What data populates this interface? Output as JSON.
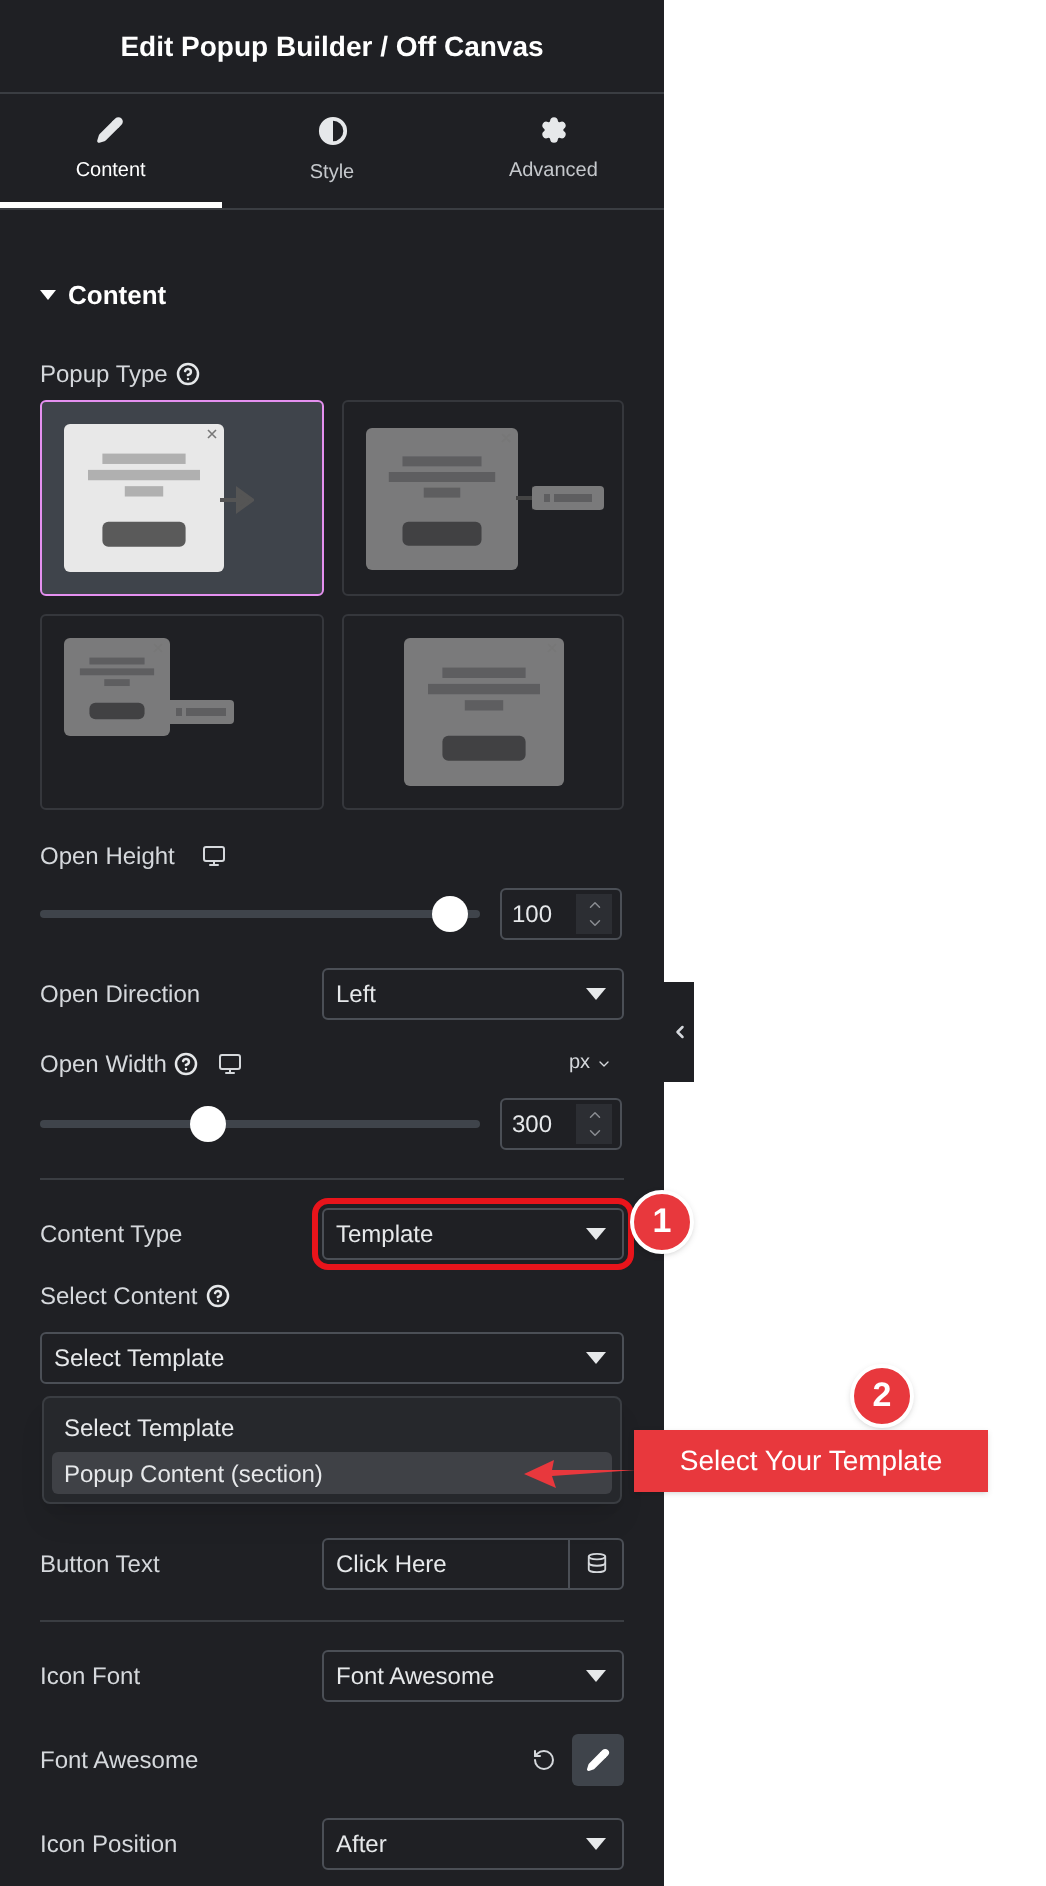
{
  "header": {
    "title": "Edit Popup Builder / Off Canvas"
  },
  "tabs": [
    {
      "label": "Content",
      "kind": "pencil",
      "selected": true
    },
    {
      "label": "Style",
      "kind": "contrast",
      "selected": false
    },
    {
      "label": "Advanced",
      "kind": "gear",
      "selected": false
    }
  ],
  "section": {
    "title": "Content",
    "expanded": true
  },
  "popup_type": {
    "label": "Popup Type",
    "options": [
      {
        "kind": "slide",
        "selected": true
      },
      {
        "kind": "slide-tab",
        "selected": false
      },
      {
        "kind": "small-tab",
        "selected": false
      },
      {
        "kind": "center",
        "selected": false
      }
    ]
  },
  "open_height": {
    "label": "Open Height",
    "level": 0.97,
    "value": "100"
  },
  "open_direction": {
    "label": "Open Direction",
    "value": "Left"
  },
  "open_width": {
    "label": "Open Width",
    "unit": "px",
    "level": 0.37,
    "value": "300"
  },
  "content_type": {
    "label": "Content Type",
    "value": "Template",
    "highlighted": true
  },
  "select_content": {
    "label": "Select Content",
    "value": "Select Template",
    "options": [
      {
        "label": "Select Template",
        "highlighted": false
      },
      {
        "label": "Popup Content (section)",
        "highlighted": true
      }
    ]
  },
  "button_text": {
    "label": "Button Text",
    "value": "Click Here"
  },
  "icon_font": {
    "label": "Icon Font",
    "value": "Font Awesome"
  },
  "font_awesome": {
    "label": "Font Awesome"
  },
  "icon_position": {
    "label": "Icon Position",
    "value": "After"
  },
  "annotations": [
    {
      "number": "1"
    },
    {
      "number": "2",
      "callout": "Select Your Template"
    }
  ]
}
